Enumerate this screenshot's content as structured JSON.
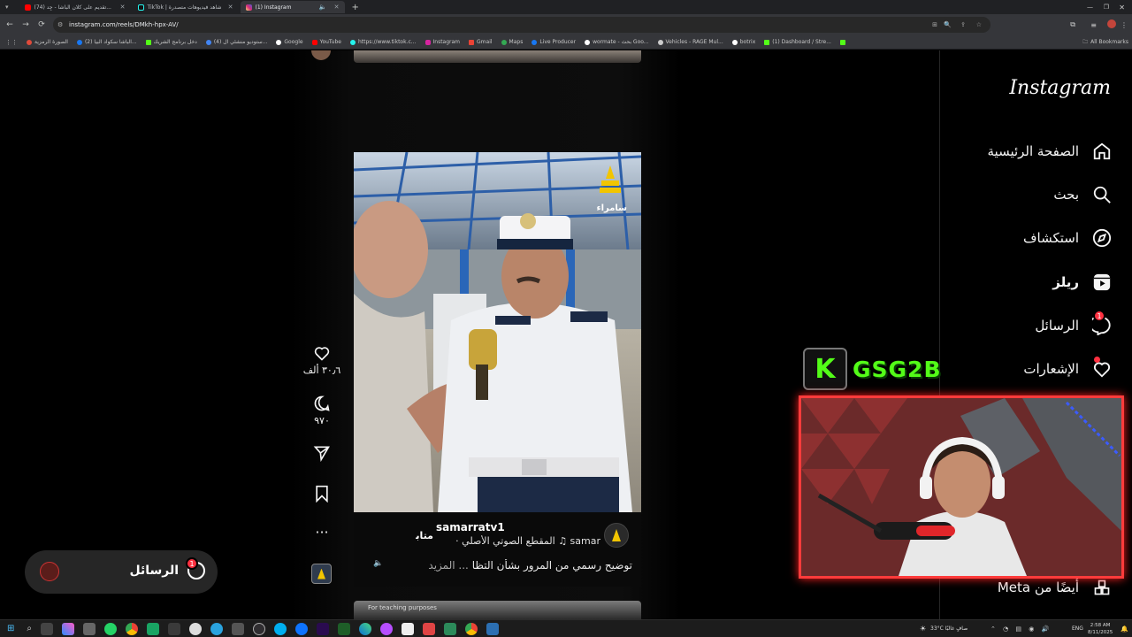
{
  "browser": {
    "tabs": [
      {
        "label": "(74) تقديم على كلان الباشا - جِد...",
        "color": "#ff0000"
      },
      {
        "label": "TikTok | شاهد فيديوهات متصدرة",
        "color": "#111111"
      },
      {
        "label": "(1) Instagram",
        "color": "#d6249f"
      }
    ],
    "url": "instagram.com/reels/DMkh-hpx-AV/",
    "bookmarks": [
      {
        "label": "الصورة الرمزية",
        "color": "#e04a3a"
      },
      {
        "label": "(2) الباشا سكواد البيا...",
        "color": "#1877f2"
      },
      {
        "label": "دخل برنامج الشريك",
        "color": "#53fc18"
      },
      {
        "label": "(4) ستوديو منشئي ال...",
        "color": "#4285f4"
      },
      {
        "label": "Google",
        "color": "#ffffff"
      },
      {
        "label": "YouTube",
        "color": "#ff0000"
      },
      {
        "label": "https://www.tiktok.c...",
        "color": "#25f4ee"
      },
      {
        "label": "Instagram",
        "color": "#d6249f"
      },
      {
        "label": "Gmail",
        "color": "#ea4335"
      },
      {
        "label": "Maps",
        "color": "#34a853"
      },
      {
        "label": "Live Producer",
        "color": "#1877f2"
      },
      {
        "label": "wormate - بحث Goo...",
        "color": "#ffffff"
      },
      {
        "label": "Vehicles - RAGE Mul...",
        "color": "#cccccc"
      },
      {
        "label": "botrix",
        "color": "#ffffff"
      },
      {
        "label": "(1) Dashboard / Stre...",
        "color": "#53fc18"
      }
    ],
    "all_bookmarks": "All Bookmarks"
  },
  "instagram": {
    "logo": "Instagram",
    "nav": [
      {
        "label": "الصفحة الرئيسية",
        "icon": "home-icon"
      },
      {
        "label": "بحث",
        "icon": "search-icon"
      },
      {
        "label": "استكشاف",
        "icon": "explore-icon"
      },
      {
        "label": "ريلز",
        "icon": "reels-icon"
      },
      {
        "label": "الرسائل",
        "icon": "messenger-icon",
        "badge": "1"
      },
      {
        "label": "الإشعارات",
        "icon": "heart-icon"
      }
    ],
    "meta_label": "أيضًا من Meta",
    "messages_pill": {
      "label": "الرسائل",
      "badge": "1"
    },
    "reel": {
      "likes": "٣٠٫٦ ألف",
      "comments": "٩٧٠",
      "username": "samarratv1",
      "follow": "متابعة",
      "audio": "samar ♫  المقطع الصوتي الأصلي ·",
      "caption": "توضيح رسمي من المرور بشأن التظا",
      "more": "... المزيد",
      "watermark": "سامراء",
      "next_caption": "For teaching purposes"
    }
  },
  "overlay": {
    "kick_brand": "GSG2B",
    "kick_letter": "K"
  },
  "taskbar": {
    "weather": "33°C  صافٍ غالبًا",
    "lang": "ENG",
    "time": "2:58 AM",
    "date": "8/11/2025",
    "colors": {
      "kick": "#53fc18",
      "ig_badge": "#ff3040"
    }
  }
}
